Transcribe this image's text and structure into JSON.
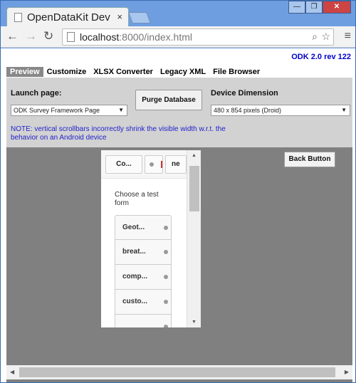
{
  "browser": {
    "tab_title": "OpenDataKit Dev",
    "tab_close": "×",
    "url_host": "localhost",
    "url_rest": ":8000/index.html",
    "win_min": "—",
    "win_max": "❐",
    "win_close": "✕"
  },
  "app": {
    "version": "ODK 2.0 rev 122",
    "nav": [
      "Preview",
      "Customize",
      "XLSX Converter",
      "Legacy XML",
      "File Browser"
    ],
    "launch_label": "Launch page:",
    "launch_value": "ODK Survey Framework Page",
    "purge_label": "Purge Database",
    "device_label": "Device Dimension",
    "device_value": "480 x 854 pixels (Droid)",
    "note": "NOTE: vertical scrollbars incorrectly shrink the visible width w.r.t. the behavior on an Android device",
    "back_label": "Back Button"
  },
  "device": {
    "btn1": "Co...",
    "btn3": "ne",
    "title": "Choose a test form",
    "forms": [
      "Geot...",
      "breat...",
      "comp...",
      "custo...",
      ""
    ]
  },
  "colors": {
    "version": "#0000cc",
    "note": "#2222cc",
    "tab_active": "#888888",
    "preview_bg": "#808080"
  }
}
